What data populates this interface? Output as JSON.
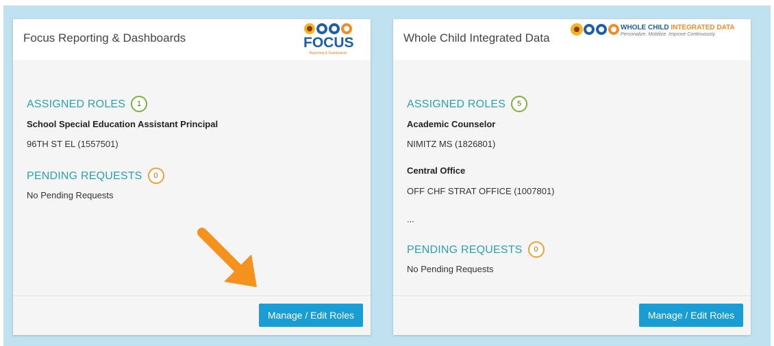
{
  "cards": [
    {
      "title": "Focus Reporting & Dashboards",
      "logo": {
        "word": "FOCUS",
        "sub": "Reporting & Dashboards"
      },
      "assigned_heading": "ASSIGNED ROLES",
      "assigned_count": "1",
      "roles": [
        {
          "name": "School Special Education Assistant Principal",
          "location": "96TH ST EL (1557501)"
        }
      ],
      "pending_heading": "PENDING REQUESTS",
      "pending_count": "0",
      "pending_text": "No Pending Requests",
      "button_label": "Manage / Edit Roles"
    },
    {
      "title": "Whole Child Integrated Data",
      "logo": {
        "title_a": "WHOLE CHILD ",
        "title_b": "INTEGRATED DATA",
        "tagline": "Personalize. Mobilize. Improve Continuously."
      },
      "assigned_heading": "ASSIGNED ROLES",
      "assigned_count": "5",
      "roles": [
        {
          "name": "Academic Counselor",
          "location": "NIMITZ MS (1826801)"
        },
        {
          "name": "Central Office",
          "location": "OFF CHF STRAT OFFICE (1007801)"
        }
      ],
      "more": "...",
      "pending_heading": "PENDING REQUESTS",
      "pending_count": "0",
      "pending_text": "No Pending Requests",
      "button_label": "Manage / Edit Roles"
    }
  ],
  "colors": {
    "accent_teal": "#2aa3a8",
    "button_blue": "#199dd2",
    "badge_green": "#7bb13a",
    "badge_orange": "#f0a030",
    "arrow_orange": "#f5921e",
    "background_blue": "#bfe1f0"
  },
  "icons": {
    "annotation": "orange-arrow-icon",
    "logo_circles": [
      "lightbulb-icon",
      "people-icon",
      "hands-icon",
      "graduation-cap-icon"
    ]
  }
}
